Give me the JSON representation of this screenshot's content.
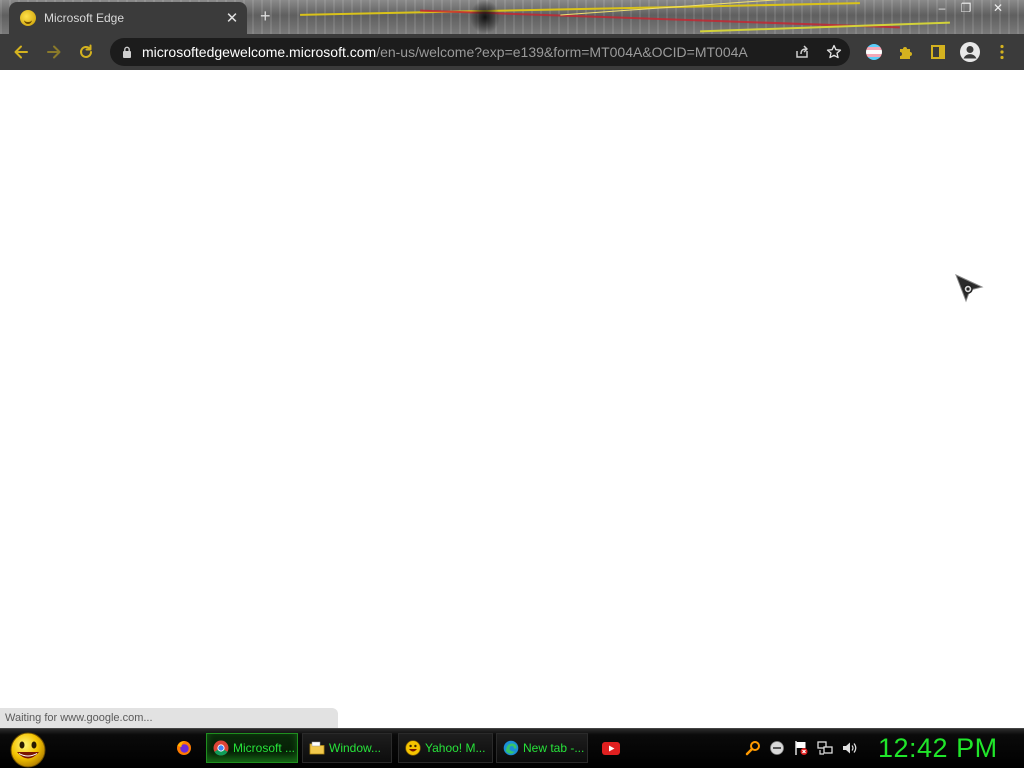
{
  "browser": {
    "tab": {
      "title": "Microsoft Edge",
      "favicon": "yahoo-smiley-icon"
    },
    "address": {
      "host": "microsoftedgewelcome.microsoft.com",
      "path": "/en-us/welcome?exp=e139&form=MT004A&OCID=MT004A"
    },
    "toolbar_icons": [
      "back-arrow-icon",
      "forward-arrow-icon",
      "reload-icon",
      "lock-icon",
      "share-icon",
      "star-icon",
      "profile-flag-icon",
      "extensions-puzzle-icon",
      "side-panel-icon",
      "account-icon",
      "menu-kebab-icon"
    ],
    "accent_icon_color": "#d4b21f"
  },
  "status_bubble": "Waiting for www.google.com...",
  "taskbar": {
    "items": [
      {
        "label": "Microsoft ...",
        "icon": "chrome-icon",
        "active": true
      },
      {
        "label": "Window...",
        "icon": "folder-icon",
        "active": false
      },
      {
        "label": "Yahoo! M...",
        "icon": "yahoo-messenger-icon",
        "active": false
      },
      {
        "label": "New tab -...",
        "icon": "edge-icon",
        "active": false
      }
    ],
    "clock": "12:42 PM",
    "text_color": "#27e33a"
  }
}
